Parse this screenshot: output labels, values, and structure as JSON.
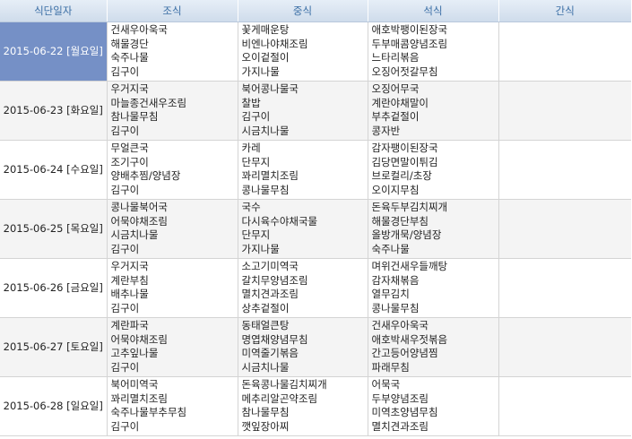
{
  "headers": {
    "date": "식단일자",
    "breakfast": "조식",
    "lunch": "중식",
    "dinner": "석식",
    "snack": "간식"
  },
  "rows": [
    {
      "date": "2015-06-22 [월요일]",
      "selected": true,
      "breakfast": [
        "건새우아욱국",
        "해물경단",
        "숙주나물",
        "김구이"
      ],
      "lunch": [
        "꽃게매운탕",
        "비엔나야채조림",
        "오이겉절이",
        "가지나물"
      ],
      "dinner": [
        "애호박팽이된장국",
        "두부매콤양념조림",
        "느타리볶음",
        "오징어젓갈무침"
      ],
      "snack": []
    },
    {
      "date": "2015-06-23 [화요일]",
      "selected": false,
      "breakfast": [
        "우거지국",
        "마늘종건새우조림",
        "참나물무침",
        "김구이"
      ],
      "lunch": [
        "북어콩나물국",
        "찰밥",
        "김구이",
        "시금치나물"
      ],
      "dinner": [
        "오징어무국",
        "계란야채말이",
        "부추겉절이",
        "콩자반"
      ],
      "snack": []
    },
    {
      "date": "2015-06-24 [수요일]",
      "selected": false,
      "breakfast": [
        "무얼큰국",
        "조기구이",
        "양배추찜/양념장",
        "김구이"
      ],
      "lunch": [
        "카레",
        "단무지",
        "꽈리멸치조림",
        "콩나물무침"
      ],
      "dinner": [
        "감자팽이된장국",
        "김당면말이튀김",
        "브로컬리/초장",
        "오이지무침"
      ],
      "snack": []
    },
    {
      "date": "2015-06-25 [목요일]",
      "selected": false,
      "breakfast": [
        "콩나물북어국",
        "어묵야채조림",
        "시금치나물",
        "김구이"
      ],
      "lunch": [
        "국수",
        "다시육수야채국물",
        "단무지",
        "가지나물"
      ],
      "dinner": [
        "돈육두부김치찌개",
        "해물경단부침",
        "올방개묵/양념장",
        "숙주나물"
      ],
      "snack": []
    },
    {
      "date": "2015-06-26 [금요일]",
      "selected": false,
      "breakfast": [
        "우거지국",
        "계란부침",
        "배추나물",
        "김구이"
      ],
      "lunch": [
        "소고기미역국",
        "갈치무양념조림",
        "멸치견과조림",
        "상추겉절이"
      ],
      "dinner": [
        "며위건새우들깨탕",
        "감자채볶음",
        "열무김치",
        "콩나물무침"
      ],
      "snack": []
    },
    {
      "date": "2015-06-27 [토요일]",
      "selected": false,
      "breakfast": [
        "계란파국",
        "어묵야채조림",
        "고추잎나물",
        "김구이"
      ],
      "lunch": [
        "동태얼큰탕",
        "명엽채양념무침",
        "미역줄기볶음",
        "시금치나물"
      ],
      "dinner": [
        "건새우아욱국",
        "애호박새우젓볶음",
        "간고등어양념찜",
        "파래무침"
      ],
      "snack": []
    },
    {
      "date": "2015-06-28 [일요일]",
      "selected": false,
      "breakfast": [
        "북어미역국",
        "꽈리멸치조림",
        "숙주나물부추무침",
        "김구이"
      ],
      "lunch": [
        "돈육콩나물김치찌개",
        "메추리알곤약조림",
        "참나물무침",
        "깻잎장아찌"
      ],
      "dinner": [
        "어묵국",
        "두부양념조림",
        "미역초양념무침",
        "멸치견과조림"
      ],
      "snack": []
    }
  ]
}
